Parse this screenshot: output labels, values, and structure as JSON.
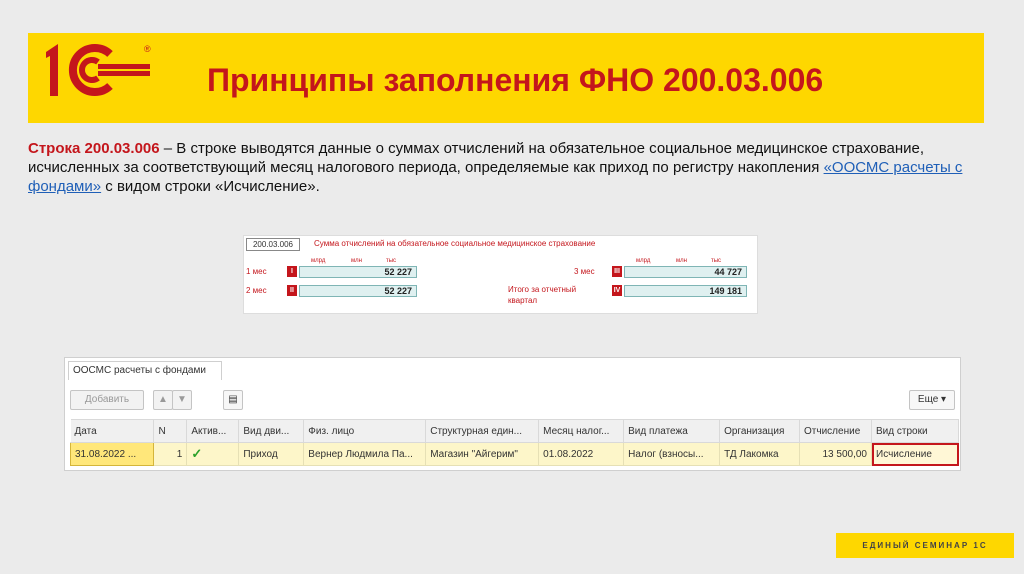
{
  "header": {
    "title": "Принципы заполнения ФНО 200.03.006"
  },
  "brand": {
    "accent": "#fed700",
    "primary": "#c4161c",
    "registered_mark": "®"
  },
  "paragraph": {
    "lead": "Строка 200.03.006",
    "text1": " – В строке выводятся данные о суммах отчислений на обязательное социальное медицинское страхование, исчисленных за соответствующий месяц налогового периода, определяемые как приход по регистру накопления ",
    "link": "«ООСМС расчеты с фондами»",
    "text2": " с видом строки «Исчисление»."
  },
  "form": {
    "code": "200.03.006",
    "title": "Сумма отчислений на обязательное социальное медицинское страхование",
    "caps": [
      "млрд",
      "млн",
      "тыс"
    ],
    "rows": [
      {
        "label": "1 мес",
        "box": "I",
        "value": "52 227"
      },
      {
        "label": "2 мес",
        "box": "II",
        "value": "52 227"
      },
      {
        "label": "3 мес",
        "box": "III",
        "value": "44 727"
      },
      {
        "label": "Итого за отчетный",
        "label2": "квартал",
        "box": "IV",
        "value": "149 181"
      }
    ]
  },
  "panel": {
    "tab": "ООСМС расчеты с фондами",
    "add_button": "Добавить",
    "more_button": "Еще",
    "columns": [
      "Дата",
      "N",
      "Актив...",
      "Вид дви...",
      "Физ. лицо",
      "Структурная един...",
      "Месяц налог...",
      "Вид платежа",
      "Организация",
      "Отчисление",
      "Вид строки"
    ],
    "row": {
      "date": "31.08.2022 ...",
      "n": "1",
      "active": "✓",
      "movement": "Приход",
      "person": "Вернер Людмила Па...",
      "unit": "Магазин \"Айгерим\"",
      "month": "01.08.2022",
      "payment": "Налог (взносы...",
      "org": "ТД Лакомка",
      "amount": "13 500,00",
      "line_type": "Исчисление"
    }
  },
  "footer": {
    "label": "ЕДИНЫЙ СЕМИНАР 1С"
  }
}
